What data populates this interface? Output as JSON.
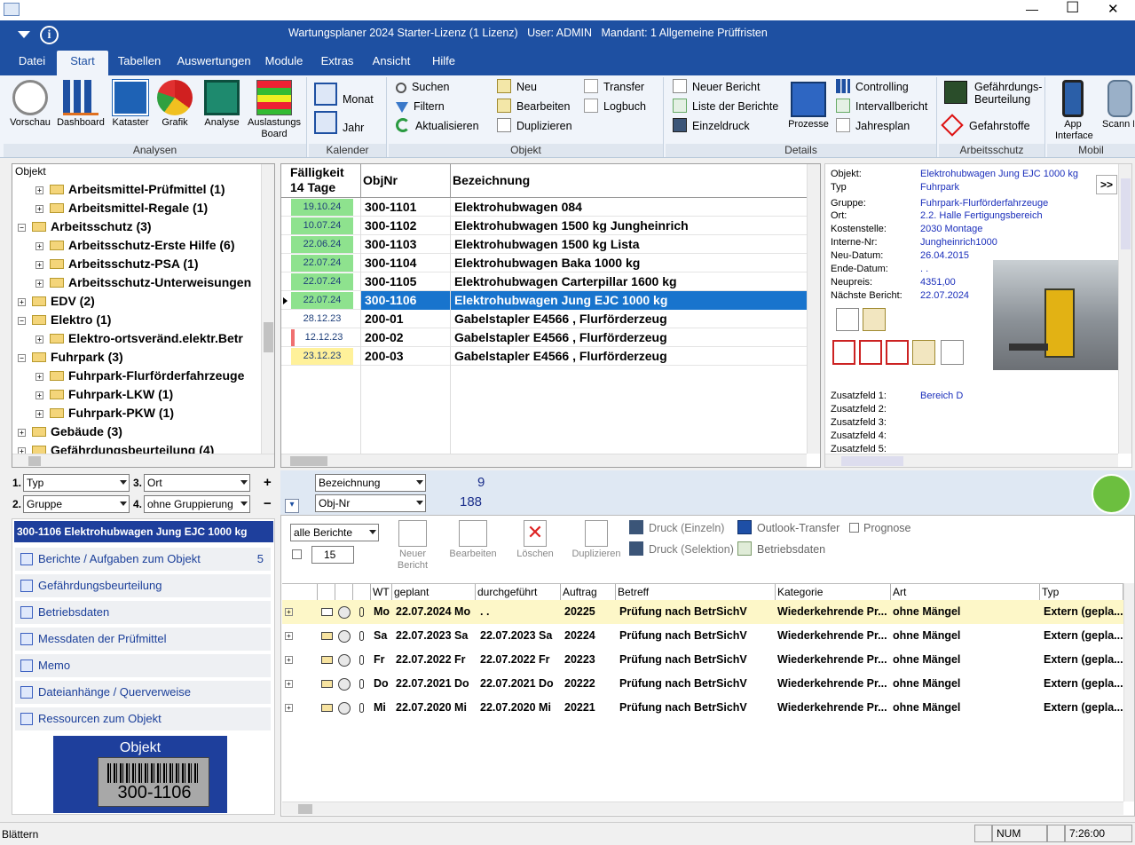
{
  "window": {
    "title": "Wartungsplaner 2024 Starter-Lizenz (1 Lizenz)   User: ADMIN   Mandant: 1 Allgemeine Prüffristen",
    "minimize": "—",
    "maximize": "☐",
    "close": "✕"
  },
  "menu": [
    "Datei",
    "Start",
    "Tabellen",
    "Auswertungen",
    "Module",
    "Extras",
    "Ansicht",
    "Hilfe"
  ],
  "ribbon": {
    "analysen": {
      "label": "Analysen",
      "buttons": [
        "Vorschau",
        "Dashboard",
        "Kataster",
        "Grafik",
        "Analyse",
        "Auslastungs Board"
      ]
    },
    "kalender": {
      "label": "Kalender",
      "buttons": [
        "Monat",
        "Jahr"
      ]
    },
    "objekt": {
      "label": "Objekt",
      "buttons": [
        "Suchen",
        "Filtern",
        "Aktualisieren",
        "Neu",
        "Bearbeiten",
        "Duplizieren",
        "Transfer",
        "Logbuch"
      ]
    },
    "details": {
      "label": "Details",
      "buttons": [
        "Neuer Bericht",
        "Liste der Berichte",
        "Einzeldruck",
        "Prozesse",
        "Controlling",
        "Intervallbericht",
        "Jahresplan"
      ]
    },
    "arbeitsschutz": {
      "label": "Arbeitsschutz",
      "buttons": [
        "Gefährdungs-Beurteilung",
        "Gefahrstoffe"
      ]
    },
    "mobil": {
      "label": "Mobil",
      "buttons": [
        "App Interface",
        "Scann Modu"
      ]
    }
  },
  "tree": {
    "header": "Objekt",
    "items": [
      {
        "label": "Arbeitsmittel-Prüfmittel  (1)",
        "level": 2,
        "pm": "+"
      },
      {
        "label": "Arbeitsmittel-Regale  (1)",
        "level": 2,
        "pm": "+"
      },
      {
        "label": "Arbeitsschutz  (3)",
        "level": 1,
        "pm": "−"
      },
      {
        "label": "Arbeitsschutz-Erste Hilfe  (6)",
        "level": 2,
        "pm": "+"
      },
      {
        "label": "Arbeitsschutz-PSA  (1)",
        "level": 2,
        "pm": "+"
      },
      {
        "label": "Arbeitsschutz-Unterweisungen",
        "level": 2,
        "pm": "+"
      },
      {
        "label": "EDV  (2)",
        "level": 1,
        "pm": "+"
      },
      {
        "label": "Elektro  (1)",
        "level": 1,
        "pm": "−"
      },
      {
        "label": "Elektro-ortsveränd.elektr.Betr",
        "level": 2,
        "pm": "+"
      },
      {
        "label": "Fuhrpark  (3)",
        "level": 1,
        "pm": "−"
      },
      {
        "label": "Fuhrpark-Flurförderfahrzeuge",
        "level": 2,
        "pm": "+"
      },
      {
        "label": "Fuhrpark-LKW  (1)",
        "level": 2,
        "pm": "+"
      },
      {
        "label": "Fuhrpark-PKW  (1)",
        "level": 2,
        "pm": "+"
      },
      {
        "label": "Gebäude  (3)",
        "level": 1,
        "pm": "+"
      },
      {
        "label": "Gefährdungsbeurteilung  (4)",
        "level": 1,
        "pm": "+"
      }
    ]
  },
  "grid": {
    "headers": [
      "Fälligkeit 14 Tage",
      "ObjNr",
      "Bezeichnung"
    ],
    "rows": [
      {
        "due": "19.10.24",
        "nr": "300-1101",
        "name": "Elektrohubwagen 084",
        "color": "#8ee28e"
      },
      {
        "due": "10.07.24",
        "nr": "300-1102",
        "name": "Elektrohubwagen 1500 kg  Jungheinrich",
        "color": "#8ee28e"
      },
      {
        "due": "22.06.24",
        "nr": "300-1103",
        "name": "Elektrohubwagen 1500 kg Lista",
        "color": "#8ee28e"
      },
      {
        "due": "22.07.24",
        "nr": "300-1104",
        "name": "Elektrohubwagen Baka 1000 kg",
        "color": "#8ee28e"
      },
      {
        "due": "22.07.24",
        "nr": "300-1105",
        "name": "Elektrohubwagen Carterpillar 1600 kg",
        "color": "#8ee28e"
      },
      {
        "due": "22.07.24",
        "nr": "300-1106",
        "name": "Elektrohubwagen Jung EJC 1000 kg",
        "color": "#8ee28e"
      },
      {
        "due": "28.12.23",
        "nr": "200-01",
        "name": "Gabelstapler E4566 , Flurförderzeug",
        "color": "#ffffff"
      },
      {
        "due": "12.12.23",
        "nr": "200-02",
        "name": "Gabelstapler E4566 , Flurförderzeug",
        "color": "#ffffff"
      },
      {
        "due": "23.12.23",
        "nr": "200-03",
        "name": "Gabelstapler E4566 , Flurförderzeug",
        "color": "#fff19a"
      }
    ]
  },
  "details": {
    "fields": [
      {
        "label": "Objekt:",
        "value": "Elektrohubwagen Jung EJC 1000 kg"
      },
      {
        "label": "Typ",
        "value": "Fuhrpark"
      },
      {
        "label": "Gruppe:",
        "value": "Fuhrpark-Flurförderfahrzeuge"
      },
      {
        "label": "Ort:",
        "value": "2.2. Halle Fertigungsbereich"
      },
      {
        "label": "Kostenstelle:",
        "value": "2030 Montage"
      },
      {
        "label": "Interne-Nr:",
        "value": "Jungheinrich1000"
      },
      {
        "label": "Neu-Datum:",
        "value": "26.04.2015"
      },
      {
        "label": "Ende-Datum:",
        "value": ". ."
      },
      {
        "label": "Neupreis:",
        "value": "4351,00"
      },
      {
        "label": "Nächste Bericht:",
        "value": "22.07.2024"
      }
    ],
    "extra": [
      {
        "label": "Zusatzfeld 1:",
        "value": "Bereich D"
      },
      {
        "label": "Zusatzfeld 2:",
        "value": ""
      },
      {
        "label": "Zusatzfeld 3:",
        "value": ""
      },
      {
        "label": "Zusatzfeld 4:",
        "value": ""
      },
      {
        "label": "Zusatzfeld 5:",
        "value": ""
      }
    ],
    "expand": ">>"
  },
  "filters": {
    "n1": "1.",
    "n2": "2.",
    "n3": "3.",
    "n4": "4.",
    "typ": "Typ",
    "gruppe": "Gruppe",
    "ort": "Ort",
    "gruppierung": "ohne Gruppierung",
    "sort1": "Bezeichnung",
    "sort2": "Obj-Nr",
    "count1": "9",
    "count2": "188"
  },
  "leftnav": {
    "title": "300-1106 Elektrohubwagen Jung EJC 1000 kg",
    "items": [
      {
        "label": "Berichte / Aufgaben zum Objekt",
        "count": "5"
      },
      {
        "label": "Gefährdungsbeurteilung",
        "count": ""
      },
      {
        "label": "Betriebsdaten",
        "count": ""
      },
      {
        "label": "Messdaten der Prüfmittel",
        "count": ""
      },
      {
        "label": "Memo",
        "count": ""
      },
      {
        "label": "Dateianhänge / Querverweise",
        "count": ""
      },
      {
        "label": "Ressourcen zum Objekt",
        "count": ""
      }
    ],
    "barcode_title": "Objekt",
    "barcode_value": "300-1106"
  },
  "reports": {
    "filter": "alle Berichte",
    "limit": "15",
    "buttons": [
      "Neuer Bericht",
      "Bearbeiten",
      "Löschen",
      "Duplizieren"
    ],
    "druck_einzeln": "Druck (Einzeln)",
    "druck_selektion": "Druck (Selektion)",
    "outlook": "Outlook-Transfer",
    "prognose": "Prognose",
    "betriebsdaten": "Betriebsdaten",
    "headers": [
      "WT",
      "geplant",
      "durchgeführt",
      "Auftrag",
      "Betreff",
      "Kategorie",
      "Art",
      "Typ"
    ],
    "rows": [
      {
        "wt": "Mo",
        "geplant": "22.07.2024 Mo",
        "done": ". .",
        "auftrag": "20225",
        "betreff": "Prüfung nach BetrSichV",
        "kat": "Wiederkehrende Pr...",
        "art": "ohne Mängel",
        "typ": "Extern (gepla..."
      },
      {
        "wt": "Sa",
        "geplant": "22.07.2023 Sa",
        "done": "22.07.2023 Sa",
        "auftrag": "20224",
        "betreff": "Prüfung nach BetrSichV",
        "kat": "Wiederkehrende Pr...",
        "art": "ohne Mängel",
        "typ": "Extern (gepla..."
      },
      {
        "wt": "Fr",
        "geplant": "22.07.2022 Fr",
        "done": "22.07.2022 Fr",
        "auftrag": "20223",
        "betreff": "Prüfung nach BetrSichV",
        "kat": "Wiederkehrende Pr...",
        "art": "ohne Mängel",
        "typ": "Extern (gepla..."
      },
      {
        "wt": "Do",
        "geplant": "22.07.2021 Do",
        "done": "22.07.2021 Do",
        "auftrag": "20222",
        "betreff": "Prüfung nach BetrSichV",
        "kat": "Wiederkehrende Pr...",
        "art": "ohne Mängel",
        "typ": "Extern (gepla..."
      },
      {
        "wt": "Mi",
        "geplant": "22.07.2020 Mi",
        "done": "22.07.2020 Mi",
        "auftrag": "20221",
        "betreff": "Prüfung nach BetrSichV",
        "kat": "Wiederkehrende Pr...",
        "art": "ohne Mängel",
        "typ": "Extern (gepla..."
      }
    ]
  },
  "status": {
    "left": "Blättern",
    "num": "NUM",
    "time": "7:26:00"
  },
  "colors": {
    "brand": "#1e50a2",
    "selection": "#1874cd",
    "link": "#1b2fbb"
  }
}
